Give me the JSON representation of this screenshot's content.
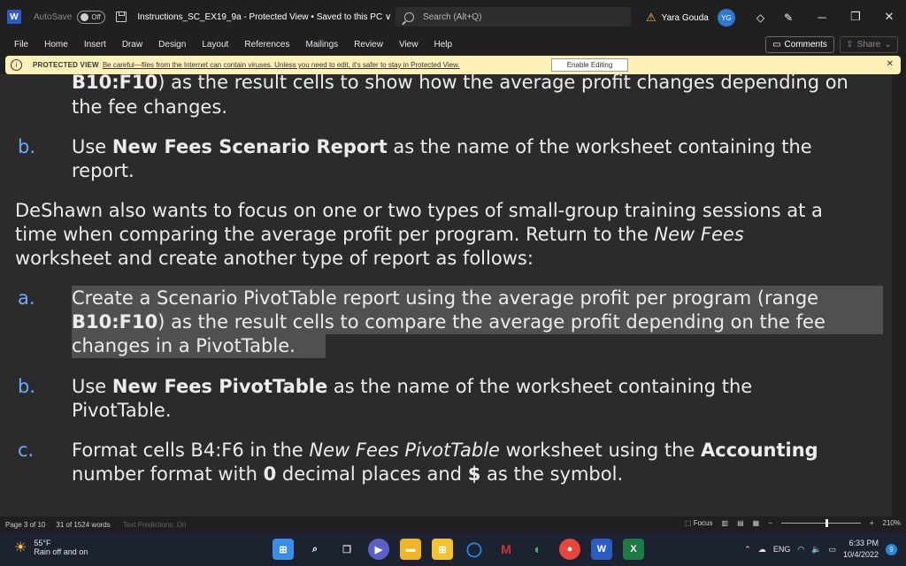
{
  "titlebar": {
    "app_logo": "W",
    "autosave_label": "AutoSave",
    "autosave_state": "Off",
    "document_title": "Instructions_SC_EX19_9a  -  Protected View • Saved to this PC ∨",
    "search_placeholder": "Search (Alt+Q)",
    "user_name": "Yara Gouda",
    "user_initials": "YG"
  },
  "menu": [
    "File",
    "Home",
    "Insert",
    "Draw",
    "Design",
    "Layout",
    "References",
    "Mailings",
    "Review",
    "View",
    "Help"
  ],
  "ribbon_buttons": {
    "comments": "Comments",
    "share": "Share"
  },
  "protected_view": {
    "label": "PROTECTED VIEW",
    "message": "Be careful—files from the Internet can contain viruses. Unless you need to edit, it's safer to stay in Protected View.",
    "enable_button": "Enable Editing"
  },
  "document": {
    "l1": {
      "bold": "B10:F10",
      "rest": ") as the result cells to show how the average profit changes depending on"
    },
    "l2": "the fee changes.",
    "b1": {
      "letter": "b.",
      "pre": "Use ",
      "bold": "New Fees Scenario Report",
      "post": " as the name of the worksheet containing the"
    },
    "b1_cont": "report.",
    "p1": "DeShawn also wants to focus on one or two types of small-group training sessions at a",
    "p2": {
      "pre": "time when comparing the average profit per program. Return to the ",
      "italic": "New Fees"
    },
    "p3": "worksheet and create another type of report as follows:",
    "a1": {
      "letter": "a.",
      "text": "Create a Scenario PivotTable report using the average profit per program (range"
    },
    "a2": {
      "bold": "B10:F10",
      "rest": ") as the result cells to compare the average profit depending on the fee"
    },
    "a3": "changes in a PivotTable.",
    "b2": {
      "letter": "b.",
      "pre": "Use ",
      "bold": "New Fees PivotTable",
      "post": " as the name of the worksheet containing the"
    },
    "b2_cont": "PivotTable.",
    "c1": {
      "letter": "c.",
      "pre": "Format cells B4:F6 in the ",
      "italic": "New Fees PivotTable",
      "mid": " worksheet using the ",
      "bold": "Accounting"
    },
    "c2": {
      "pre": "number format with ",
      "bold0": "0",
      "mid": " decimal places and ",
      "bold1": "$",
      "post": " as the symbol."
    }
  },
  "statusbar": {
    "page": "Page 3 of 10",
    "words": "31 of 1524 words",
    "predictions": "Text Predictions: On",
    "focus": "Focus",
    "zoom": "210%"
  },
  "taskbar": {
    "temperature": "55°F",
    "weather": "Rain off and on",
    "lang": "ENG",
    "time": "6:33 PM",
    "date": "10/4/2022",
    "notifications": "9"
  }
}
